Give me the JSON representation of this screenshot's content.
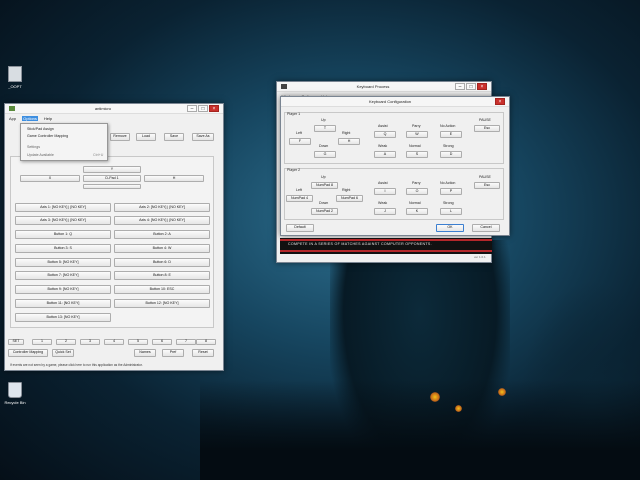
{
  "desktop": {
    "top_icon_label": "_OOPT",
    "recycle_bin_label": "Recycle Bin"
  },
  "antimicro": {
    "title": "antimicro",
    "menu": [
      "App",
      "Options",
      "Help"
    ],
    "dropdown_items": [
      "Stick/Pad Assign",
      "Game Controller Mapping",
      "Settings",
      "Update Available"
    ],
    "dropdown_shortcut": "Ctrl+U",
    "toolbar": [
      "Remove",
      "Load",
      "Save",
      "Save As"
    ],
    "dpad_up": "Y",
    "dpad_left": "X",
    "dpad_center": "D-Pad 1",
    "dpad_right": "H",
    "buttons_left": [
      "Axis 1: [NO KEY] | [NO KEY]",
      "Axis 3: [NO KEY] | [NO KEY]",
      "Button 1: Q",
      "Button 3: S",
      "Button 5: [NO KEY]",
      "Button 7: [NO KEY]",
      "Button 9: [NO KEY]",
      "Button 11: [NO KEY]",
      "Button 13: [NO KEY]"
    ],
    "buttons_right": [
      "Axis 2: [NO KEY] | [NO KEY]",
      "Axis 4: [NO KEY] | [NO KEY]",
      "Button 2: A",
      "Button 4: W",
      "Button 6: D",
      "Button 8: E",
      "Button 10: ESC",
      "Button 12: [NO KEY]"
    ],
    "set_label": "SET",
    "set_tabs": [
      "1",
      "2",
      "3",
      "4",
      "5",
      "6",
      "7",
      "8"
    ],
    "controller_mapping": "Controller Mapping",
    "quick_set": "Quick Set",
    "names": "Names",
    "pref": "Pref",
    "reset": "Reset",
    "status": "If events are not seen by a game, please click here to run this application as the Administrator."
  },
  "keyboard_process": {
    "title": "Keyboard Process",
    "menu": [
      "Window",
      "Options",
      "Help"
    ],
    "config_title": "Keyboard Configuration",
    "player1": {
      "heading": "Player 1",
      "up_label": "Up",
      "up_key": "T",
      "left_label": "Left",
      "left_key": "F",
      "right_label": "Right",
      "right_key": "H",
      "down_label": "Down",
      "down_key": "G",
      "assist_label": "Assist",
      "assist_key": "Q",
      "parry_label": "Parry",
      "parry_key": "W",
      "noaction_label": "No Action",
      "noaction_key": "E",
      "weak_label": "Weak",
      "weak_key": "A",
      "normal_label": "Normal",
      "normal_key": "S",
      "strong_label": "Strong",
      "strong_key": "D",
      "pause_label": "PAUSE",
      "pause_key": "Esc"
    },
    "player2": {
      "heading": "Player 2",
      "up_label": "Up",
      "up_key": "NumPad 8",
      "left_label": "Left",
      "left_key": "NumPad 4",
      "right_label": "Right",
      "right_key": "NumPad 6",
      "down_label": "Down",
      "down_key": "NumPad 2",
      "assist_label": "Assist",
      "assist_key": "I",
      "parry_label": "Parry",
      "parry_key": "O",
      "noaction_label": "No Action",
      "noaction_key": "P",
      "weak_label": "Weak",
      "weak_key": "J",
      "normal_label": "Normal",
      "normal_key": "K",
      "strong_label": "Strong",
      "strong_key": "L",
      "pause_label": "PAUSE",
      "pause_key": "Esc"
    },
    "default_btn": "Default",
    "ok_btn": "OK",
    "cancel_btn": "Cancel",
    "banner_text": "COMPETE IN A SERIES OF MATCHES AGAINST COMPUTER OPPONENTS.",
    "version": "ver 1.0.1"
  },
  "colors": {
    "close": "#c9302c",
    "banner_red": "#b3272a",
    "banner_bg": "#111111"
  }
}
